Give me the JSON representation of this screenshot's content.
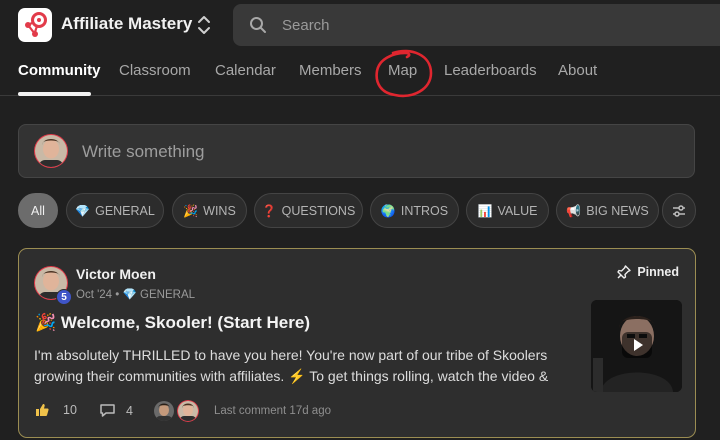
{
  "app": {
    "title": "Affiliate Mastery"
  },
  "search": {
    "placeholder": "Search"
  },
  "nav": {
    "tabs": [
      {
        "label": "Community",
        "active": true
      },
      {
        "label": "Classroom"
      },
      {
        "label": "Calendar"
      },
      {
        "label": "Members"
      },
      {
        "label": "Map"
      },
      {
        "label": "Leaderboards"
      },
      {
        "label": "About"
      }
    ]
  },
  "composer": {
    "placeholder": "Write something"
  },
  "filters": [
    {
      "label": "All",
      "emoji": "",
      "active": true
    },
    {
      "label": "GENERAL",
      "emoji": "💎"
    },
    {
      "label": "WINS",
      "emoji": "🎉"
    },
    {
      "label": "QUESTIONS",
      "emoji": "❓"
    },
    {
      "label": "INTROS",
      "emoji": "🌍"
    },
    {
      "label": "VALUE",
      "emoji": "📊"
    },
    {
      "label": "BIG NEWS",
      "emoji": "📢"
    }
  ],
  "post": {
    "author": "Victor Moen",
    "level": "5",
    "date": "Oct '24",
    "category": "GENERAL",
    "category_emoji": "💎",
    "pinned_label": "Pinned",
    "title_emoji": "🎉",
    "title": "Welcome, Skooler! (Start Here)",
    "body": "I'm absolutely THRILLED to have you here! You're now part of our tribe of Skoolers growing their communities with affiliates. ⚡ To get things rolling, watch the video &",
    "likes": "10",
    "comments": "4",
    "last_comment": "Last comment 17d ago"
  },
  "colors": {
    "accent_border": "#9b8d52",
    "brand": "#e23b4a",
    "level_badge": "#3f55c8"
  }
}
